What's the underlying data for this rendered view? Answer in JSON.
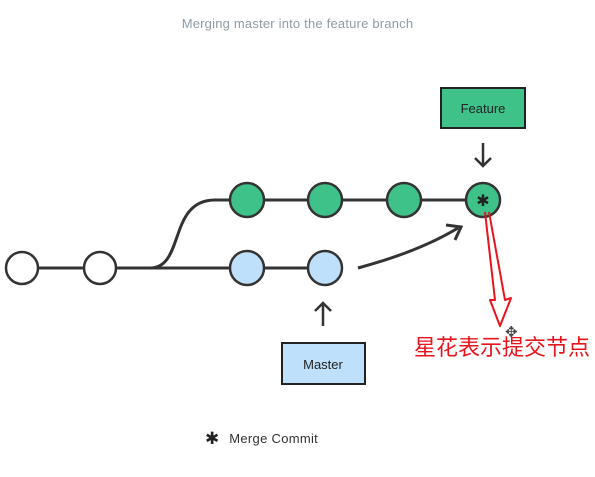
{
  "title": "Merging master into the feature branch",
  "boxes": {
    "feature": {
      "label": "Feature",
      "fill": "#3fc18a",
      "stroke": "#222222"
    },
    "master": {
      "label": "Master",
      "fill": "#bfe0fb",
      "stroke": "#222222"
    }
  },
  "colors": {
    "commit_neutral": "#ffffff",
    "commit_feature": "#3fc18a",
    "commit_master": "#bfe0fb",
    "line": "#333333",
    "annotation": "#e8141b"
  },
  "merge_symbol": "✱",
  "annotation_text": "星花表示提交节点",
  "legend": {
    "symbol": "✱",
    "label": "Merge Commit",
    "symbol_icon": "asterisk-icon"
  },
  "cursor_icon": "move-cursor-icon"
}
